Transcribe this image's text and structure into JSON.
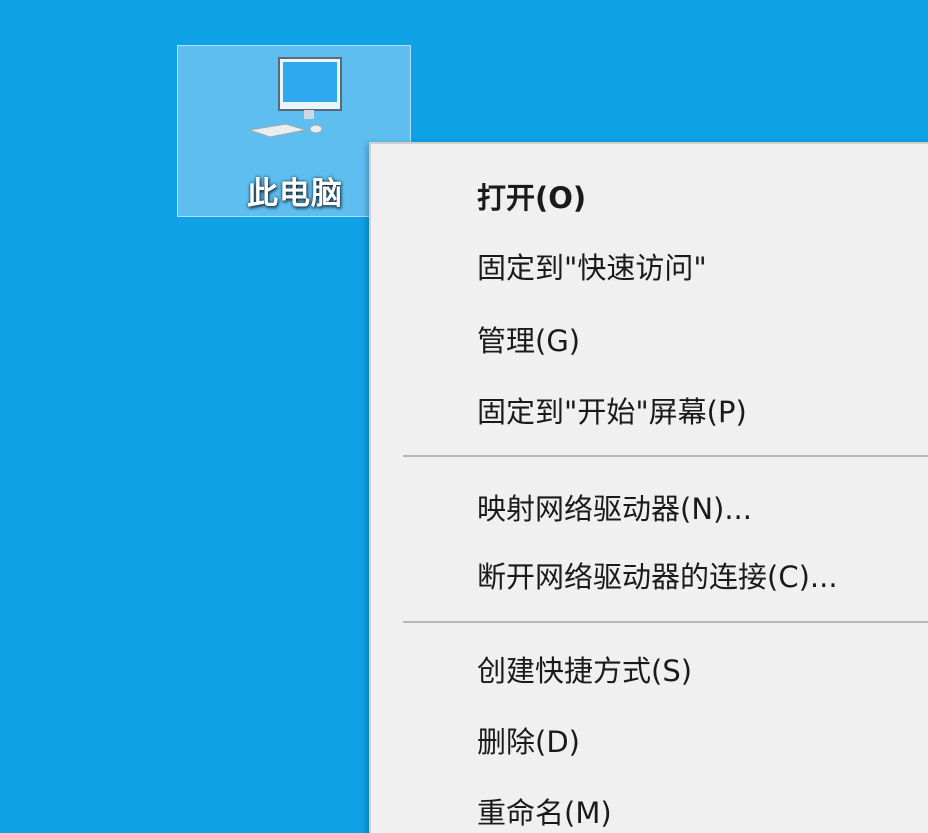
{
  "desktop": {
    "background_color": "#0ea1e6",
    "icon": {
      "label": "此电脑",
      "icon_name": "this-pc-icon"
    }
  },
  "context_menu": {
    "groups": [
      [
        {
          "label": "打开(O)",
          "bold": true
        },
        {
          "label": "固定到\"快速访问\""
        },
        {
          "label": "管理(G)"
        },
        {
          "label": "固定到\"开始\"屏幕(P)"
        }
      ],
      [
        {
          "label": "映射网络驱动器(N)..."
        },
        {
          "label": "断开网络驱动器的连接(C)..."
        }
      ],
      [
        {
          "label": "创建快捷方式(S)"
        },
        {
          "label": "删除(D)"
        },
        {
          "label": "重命名(M)"
        }
      ]
    ]
  }
}
